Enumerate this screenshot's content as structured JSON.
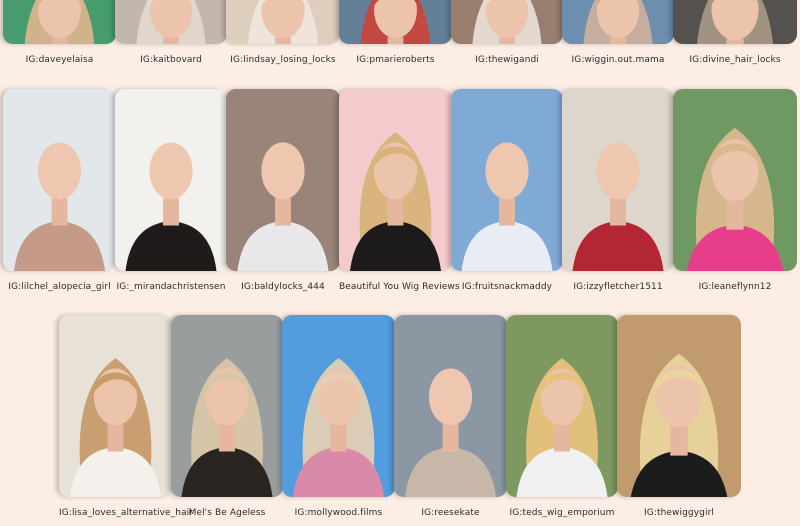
{
  "gallery": {
    "row1": [
      {
        "caption": "IG:daveyelaisa",
        "palette": [
          "#2e8f5b",
          "#d8b48d",
          "#1f6d43"
        ]
      },
      {
        "caption": "IG:kaitbovard",
        "palette": [
          "#b9aea4",
          "#e2d7cd",
          "#7d6f66"
        ]
      },
      {
        "caption": "IG:lindsay_losing_locks",
        "palette": [
          "#d9c8b6",
          "#efe5da",
          "#a88f77"
        ]
      },
      {
        "caption": "IG:pmarieroberts",
        "palette": [
          "#4f6e8a",
          "#c7463c",
          "#e3b59a"
        ]
      },
      {
        "caption": "IG:thewigandi",
        "palette": [
          "#8a6d5a",
          "#e8ddd3",
          "#3a2a22"
        ]
      },
      {
        "caption": "IG:wiggin.out.mama",
        "palette": [
          "#5b7fa6",
          "#c9b09c",
          "#34506e"
        ]
      },
      {
        "caption": "IG:divine_hair_locks",
        "palette": [
          "#3d3a36",
          "#a59685",
          "#2f4f3b"
        ]
      }
    ],
    "row2": [
      {
        "caption": "IG:lilchel_alopecia_girl",
        "palette": [
          "#dfe4ea",
          "#f0d0c0",
          "#c59a88"
        ]
      },
      {
        "caption": "IG:_mirandachristensen",
        "palette": [
          "#f2efec",
          "#f1cdb7",
          "#1e1b1a"
        ]
      },
      {
        "caption": "IG:baldylocks_444",
        "palette": [
          "#8a7466",
          "#d29f84",
          "#e8e8ea"
        ]
      },
      {
        "caption": "Beautiful You Wig Reviews",
        "palette": [
          "#f4c3c7",
          "#d8b27a",
          "#1c1a1a"
        ]
      },
      {
        "caption": "IG:fruitsnackmaddy",
        "palette": [
          "#6f9fd1",
          "#e2b59b",
          "#e8edf4"
        ]
      },
      {
        "caption": "IG:izzyfletcher1511",
        "palette": [
          "#d9d1c6",
          "#efc9b6",
          "#b32633"
        ]
      },
      {
        "caption": "IG:leaneflynn12",
        "palette": [
          "#5d8a4e",
          "#d9b88d",
          "#e83d8a"
        ]
      }
    ],
    "row3": [
      {
        "caption": "IG:lisa_loves_alternative_hair",
        "palette": [
          "#e4ddd3",
          "#c79b6c",
          "#f4f1ec"
        ]
      },
      {
        "caption": "Mel's Be Ageless",
        "palette": [
          "#8d9091",
          "#d8c6a8",
          "#2b2522"
        ]
      },
      {
        "caption": "IG:mollywood.films",
        "palette": [
          "#3c8fd9",
          "#e2cfb4",
          "#d98aa8"
        ]
      },
      {
        "caption": "IG:reesekate",
        "palette": [
          "#7b8a98",
          "#d7a185",
          "#c6b7a9"
        ]
      },
      {
        "caption": "IG:teds_wig_emporium",
        "palette": [
          "#6c8b4b",
          "#e6c27c",
          "#f0f0f0"
        ]
      },
      {
        "caption": "IG:thewiggygirl",
        "palette": [
          "#b98c5b",
          "#e9d49d",
          "#1c1c1c"
        ]
      }
    ]
  }
}
